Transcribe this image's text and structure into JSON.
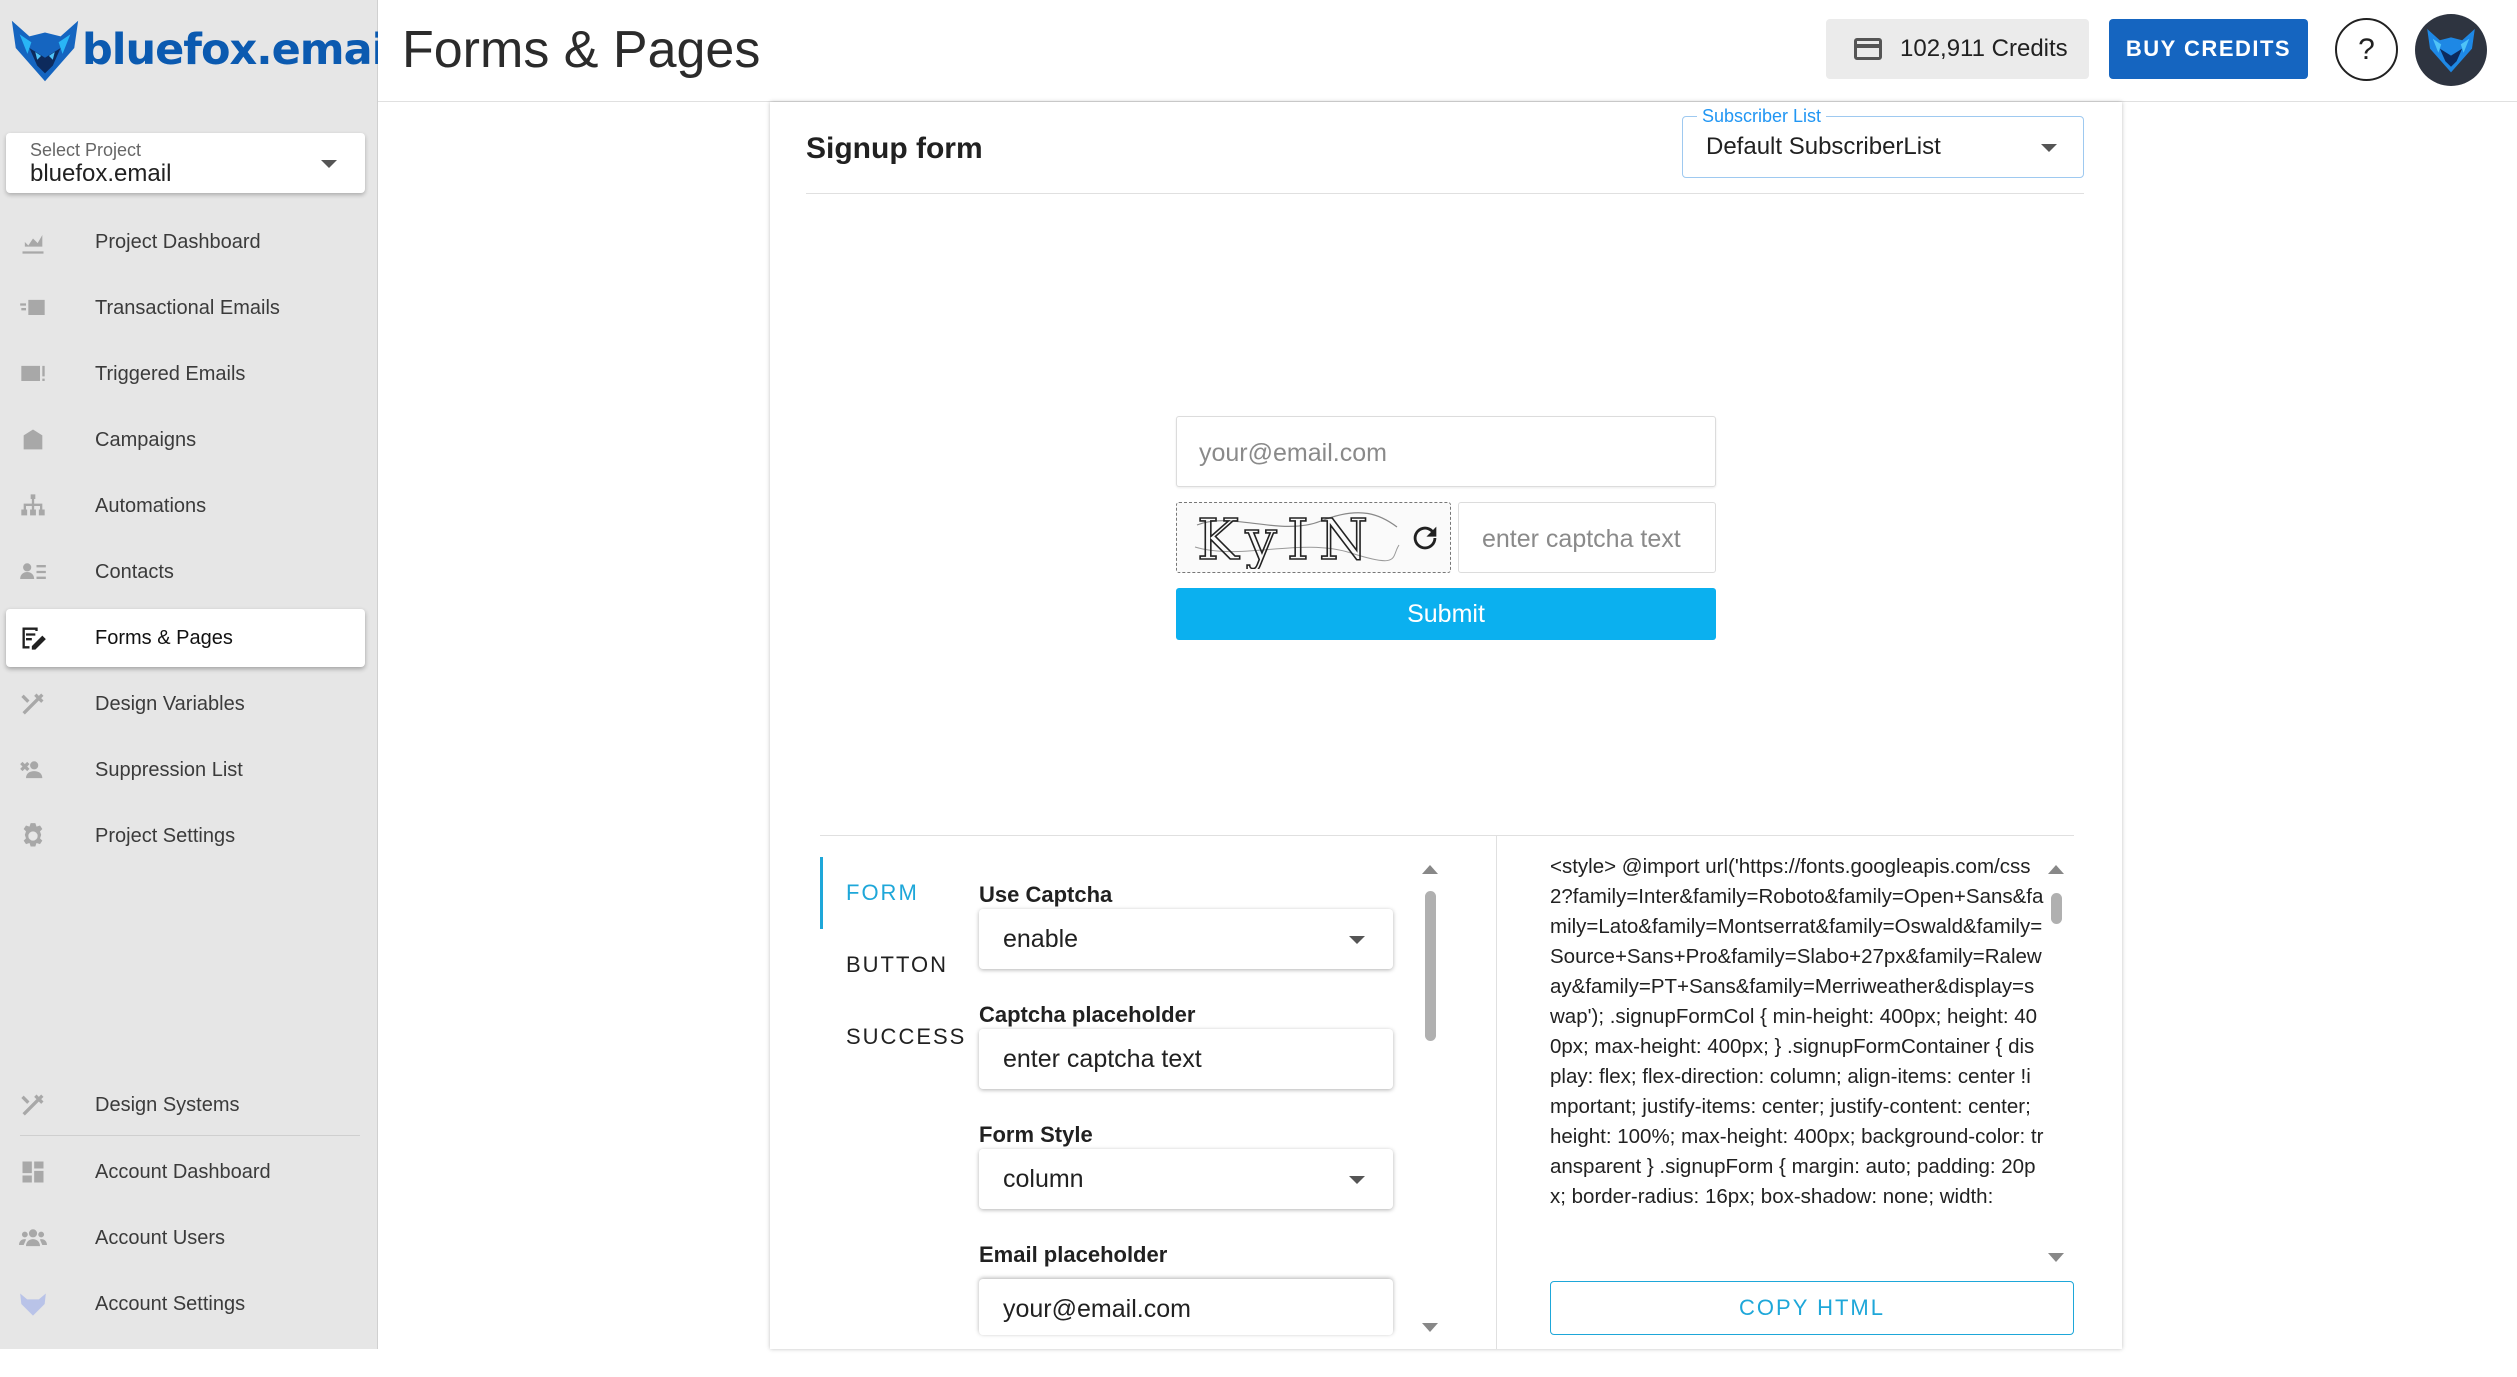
{
  "brand": {
    "name": "bluefox.email",
    "logo": "fox-logo-icon"
  },
  "project_select": {
    "label": "Select Project",
    "value": "bluefox.email"
  },
  "sidebar": {
    "items": [
      {
        "label": "Project Dashboard",
        "icon": "chart-icon"
      },
      {
        "label": "Transactional Emails",
        "icon": "transactional-email-icon"
      },
      {
        "label": "Triggered Emails",
        "icon": "triggered-email-icon"
      },
      {
        "label": "Campaigns",
        "icon": "campaign-icon"
      },
      {
        "label": "Automations",
        "icon": "sitemap-icon"
      },
      {
        "label": "Contacts",
        "icon": "contacts-icon"
      },
      {
        "label": "Forms & Pages",
        "icon": "form-edit-icon",
        "active": true
      },
      {
        "label": "Design Variables",
        "icon": "design-tools-icon"
      },
      {
        "label": "Suppression List",
        "icon": "users-blocked-icon"
      },
      {
        "label": "Project Settings",
        "icon": "gear-icon"
      }
    ],
    "bottom_items": [
      {
        "label": "Design Systems",
        "icon": "design-tools-icon"
      },
      {
        "label": "Account Dashboard",
        "icon": "dashboard-icon"
      },
      {
        "label": "Account Users",
        "icon": "users-icon"
      },
      {
        "label": "Account Settings",
        "icon": "fox-logo-icon"
      }
    ]
  },
  "header": {
    "title": "Forms & Pages",
    "credits": "102,911 Credits",
    "buy_label": "BUY CREDITS",
    "help_label": "?"
  },
  "form": {
    "title": "Signup form",
    "subscriber_list": {
      "label": "Subscriber List",
      "value": "Default SubscriberList"
    }
  },
  "preview": {
    "email_placeholder": "your@email.com",
    "captcha_text": "KyIN",
    "captcha_placeholder": "enter captcha text",
    "submit_label": "Submit",
    "submit_color": "#0bb0ef"
  },
  "editor": {
    "tabs": [
      {
        "label": "FORM",
        "active": true
      },
      {
        "label": "BUTTON"
      },
      {
        "label": "SUCCESS"
      }
    ],
    "fields": [
      {
        "label": "Use Captcha",
        "value": "enable",
        "type": "select"
      },
      {
        "label": "Captcha placeholder",
        "value": "enter captcha text",
        "type": "text"
      },
      {
        "label": "Form Style",
        "value": "column",
        "type": "select"
      },
      {
        "label": "Email placeholder",
        "value": "your@email.com",
        "type": "text"
      }
    ],
    "code": "<style> @import url('https://fonts.googleapis.com/css2?family=Inter&family=Roboto&family=Open+Sans&family=Lato&family=Montserrat&family=Oswald&family=Source+Sans+Pro&family=Slabo+27px&family=Raleway&family=PT+Sans&family=Merriweather&display=swap'); .signupFormCol { min-height: 400px; height: 400px; max-height: 400px; } .signupFormContainer { display: flex; flex-direction: column; align-items: center !important; justify-items: center; justify-content: center; height: 100%; max-height: 400px; background-color: transparent } .signupForm { margin: auto; padding: 20px; border-radius: 16px; box-shadow: none; width:",
    "copy_label": "COPY HTML"
  },
  "colors": {
    "accent": "#1ea7d9",
    "primary": "#1565c0",
    "brand": "#0b5ab0"
  }
}
